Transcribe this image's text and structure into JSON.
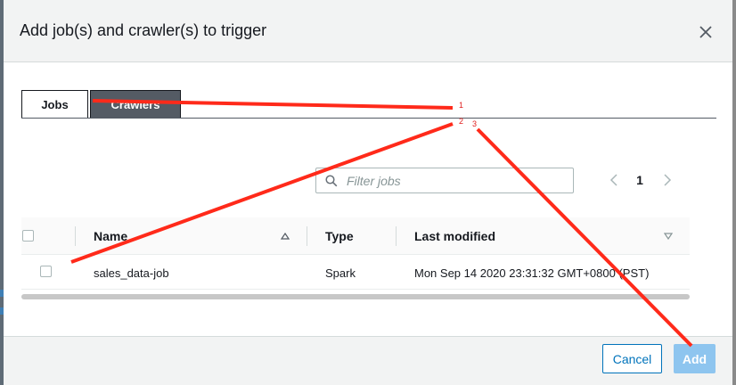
{
  "dialog": {
    "title": "Add job(s) and crawler(s) to trigger",
    "close_icon": "close-icon"
  },
  "tabs": [
    {
      "label": "Jobs",
      "selected": true
    },
    {
      "label": "Crawlers",
      "selected": false
    }
  ],
  "search": {
    "placeholder": "Filter jobs",
    "value": ""
  },
  "pagination": {
    "current_page": "1"
  },
  "table": {
    "columns": [
      "Name",
      "Type",
      "Last modified"
    ],
    "rows": [
      {
        "name": "sales_data-job",
        "type": "Spark",
        "last_modified": "Mon Sep 14 2020 23:31:32 GMT+0800 (PST)"
      }
    ]
  },
  "footer": {
    "cancel_label": "Cancel",
    "add_label": "Add"
  },
  "annotations": {
    "labels": [
      "1",
      "2",
      "3"
    ],
    "color": "#e02020"
  },
  "colors": {
    "primary": "#0073bb",
    "primary_disabled": "#8ec5ef",
    "tab_dark": "#545b64"
  }
}
